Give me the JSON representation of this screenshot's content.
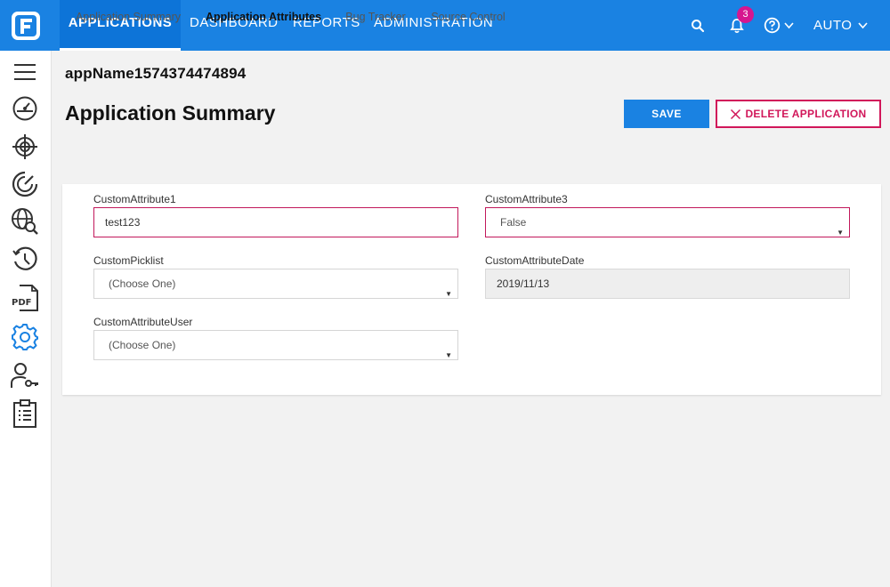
{
  "topnav": {
    "items": [
      {
        "label": "APPLICATIONS",
        "active": true
      },
      {
        "label": "DASHBOARD",
        "active": false
      },
      {
        "label": "REPORTS",
        "active": false
      },
      {
        "label": "ADMINISTRATION",
        "active": false
      }
    ],
    "notification_count": "3",
    "user_label": "AUTO"
  },
  "sidebar": {
    "icons": [
      "menu-icon",
      "dashboard-gauge-icon",
      "target-icon",
      "speedometer-icon",
      "globe-search-icon",
      "history-icon",
      "pdf-icon",
      "settings-gear-icon",
      "user-key-icon",
      "clipboard-list-icon"
    ],
    "active_icon": "settings-gear-icon"
  },
  "header": {
    "app_name": "appName1574374474894",
    "title": "Application Summary",
    "save_label": "SAVE",
    "delete_label": "DELETE APPLICATION"
  },
  "tabs": [
    {
      "label": "Application Summary",
      "active": false
    },
    {
      "label": "Application Attributes",
      "active": true
    },
    {
      "label": "Bug Tracker",
      "active": false
    },
    {
      "label": "Source Control",
      "active": false
    }
  ],
  "form": {
    "custom_attribute_1": {
      "label": "CustomAttribute1",
      "value": "test123"
    },
    "custom_attribute_3": {
      "label": "CustomAttribute3",
      "value": "False"
    },
    "custom_picklist": {
      "label": "CustomPicklist",
      "value": "(Choose One)"
    },
    "custom_attribute_date": {
      "label": "CustomAttributeDate",
      "value": "2019/11/13"
    },
    "custom_attribute_user": {
      "label": "CustomAttributeUser",
      "value": "(Choose One)"
    }
  },
  "colors": {
    "primary": "#1a82e2",
    "danger": "#d1175a",
    "badge": "#d6168f",
    "sidebar_icon": "#333333",
    "sidebar_icon_active": "#1a82e2"
  }
}
